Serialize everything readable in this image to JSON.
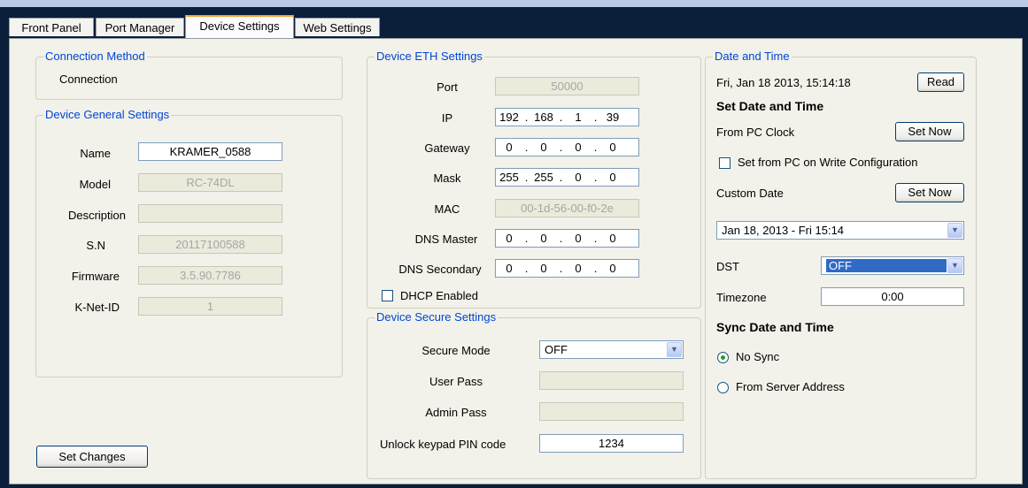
{
  "tabs": [
    {
      "label": "Front Panel"
    },
    {
      "label": "Port Manager"
    },
    {
      "label": "Device Settings"
    },
    {
      "label": "Web Settings"
    }
  ],
  "connection_method": {
    "title": "Connection Method",
    "value": "Connection"
  },
  "general": {
    "title": "Device General Settings",
    "name_label": "Name",
    "name_value": "KRAMER_0588",
    "model_label": "Model",
    "model_value": "RC-74DL",
    "description_label": "Description",
    "description_value": "",
    "sn_label": "S.N",
    "sn_value": "20117100588",
    "firmware_label": "Firmware",
    "firmware_value": "3.5.90.7786",
    "knet_label": "K-Net-ID",
    "knet_value": "1"
  },
  "eth": {
    "title": "Device ETH Settings",
    "port_label": "Port",
    "port_value": "50000",
    "ip_label": "IP",
    "ip": [
      "192",
      "168",
      "1",
      "39"
    ],
    "gateway_label": "Gateway",
    "gateway": [
      "0",
      "0",
      "0",
      "0"
    ],
    "mask_label": "Mask",
    "mask": [
      "255",
      "255",
      "0",
      "0"
    ],
    "mac_label": "MAC",
    "mac_value": "00-1d-56-00-f0-2e",
    "dns_master_label": "DNS Master",
    "dns_master": [
      "0",
      "0",
      "0",
      "0"
    ],
    "dns_secondary_label": "DNS Secondary",
    "dns_secondary": [
      "0",
      "0",
      "0",
      "0"
    ],
    "dhcp_label": "DHCP Enabled",
    "dhcp_checked": false
  },
  "secure": {
    "title": "Device Secure Settings",
    "mode_label": "Secure Mode",
    "mode_value": "OFF",
    "user_pass_label": "User Pass",
    "user_pass_value": "",
    "admin_pass_label": "Admin Pass",
    "admin_pass_value": "",
    "pin_label": "Unlock keypad PIN code",
    "pin_value": "1234"
  },
  "datetime": {
    "title": "Date and Time",
    "current": "Fri, Jan 18 2013, 15:14:18",
    "read_button": "Read",
    "set_heading": "Set Date and Time",
    "from_pc_label": "From PC Clock",
    "set_now_button": "Set Now",
    "set_on_write_label": "Set from PC on Write Configuration",
    "set_on_write_checked": false,
    "custom_date_label": "Custom Date",
    "custom_set_now_button": "Set Now",
    "date_picker_value": "Jan 18, 2013 -  Fri  15:14",
    "dst_label": "DST",
    "dst_value": "OFF",
    "timezone_label": "Timezone",
    "timezone_value": "0:00",
    "sync_heading": "Sync Date and Time",
    "no_sync_label": "No Sync",
    "from_server_label": "From Server Address",
    "sync_selected": "No Sync"
  },
  "actions": {
    "set_changes_button": "Set Changes"
  },
  "colors": {
    "group_title": "#0046d5",
    "active_tab_accent": "#f2a52a",
    "selection_highlight": "#316ac5",
    "window_background": "#0b1e3a"
  }
}
